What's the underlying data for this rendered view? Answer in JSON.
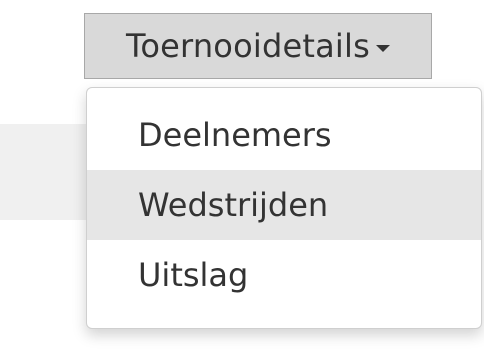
{
  "dropdown": {
    "toggle_label": "Toernooidetails",
    "toggle_icon": "caret-down-icon",
    "items": [
      {
        "label": "Deelnemers",
        "highlighted": false
      },
      {
        "label": "Wedstrijden",
        "highlighted": true
      },
      {
        "label": "Uitslag",
        "highlighted": false
      }
    ]
  },
  "colors": {
    "button_bg": "#d9d9d9",
    "highlight_bg": "#e6e6e6",
    "text": "#333333"
  }
}
